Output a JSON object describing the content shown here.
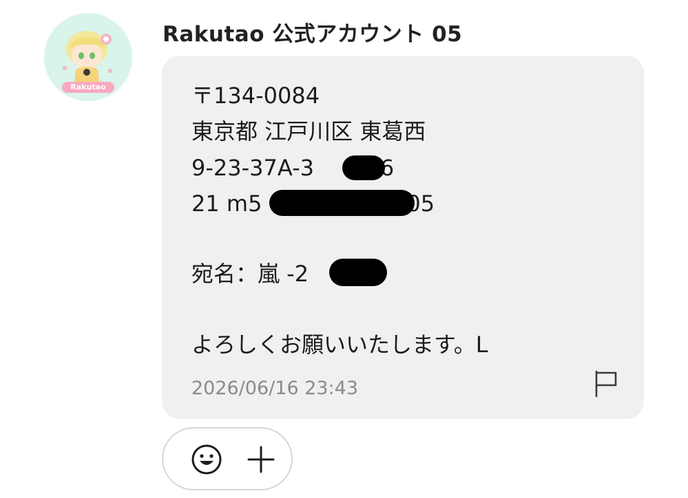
{
  "message": {
    "sender_name": "Rakutao 公式アカウント 05",
    "avatar": {
      "icon": "avatar-icon",
      "logo_text": "Rakutao"
    },
    "lines": [
      "〒134-0084",
      "東京都 江戸川区 東葛西",
      "9-23-37A-3",
      "-16",
      "21 m5",
      "05",
      "宛名：嵐 -2",
      "6",
      "よろしくお願いいたします。L"
    ],
    "timestamp": "2026/06/16 23:43",
    "flag_icon": "flag-icon"
  },
  "reactions": {
    "emoji_icon": "smiley-icon",
    "add_icon": "plus-icon"
  },
  "colors": {
    "bubble_bg": "#f0f0f0",
    "timestamp": "#8a8a8a",
    "avatar_bg": "#d7f3e9",
    "redaction": "#000000"
  }
}
